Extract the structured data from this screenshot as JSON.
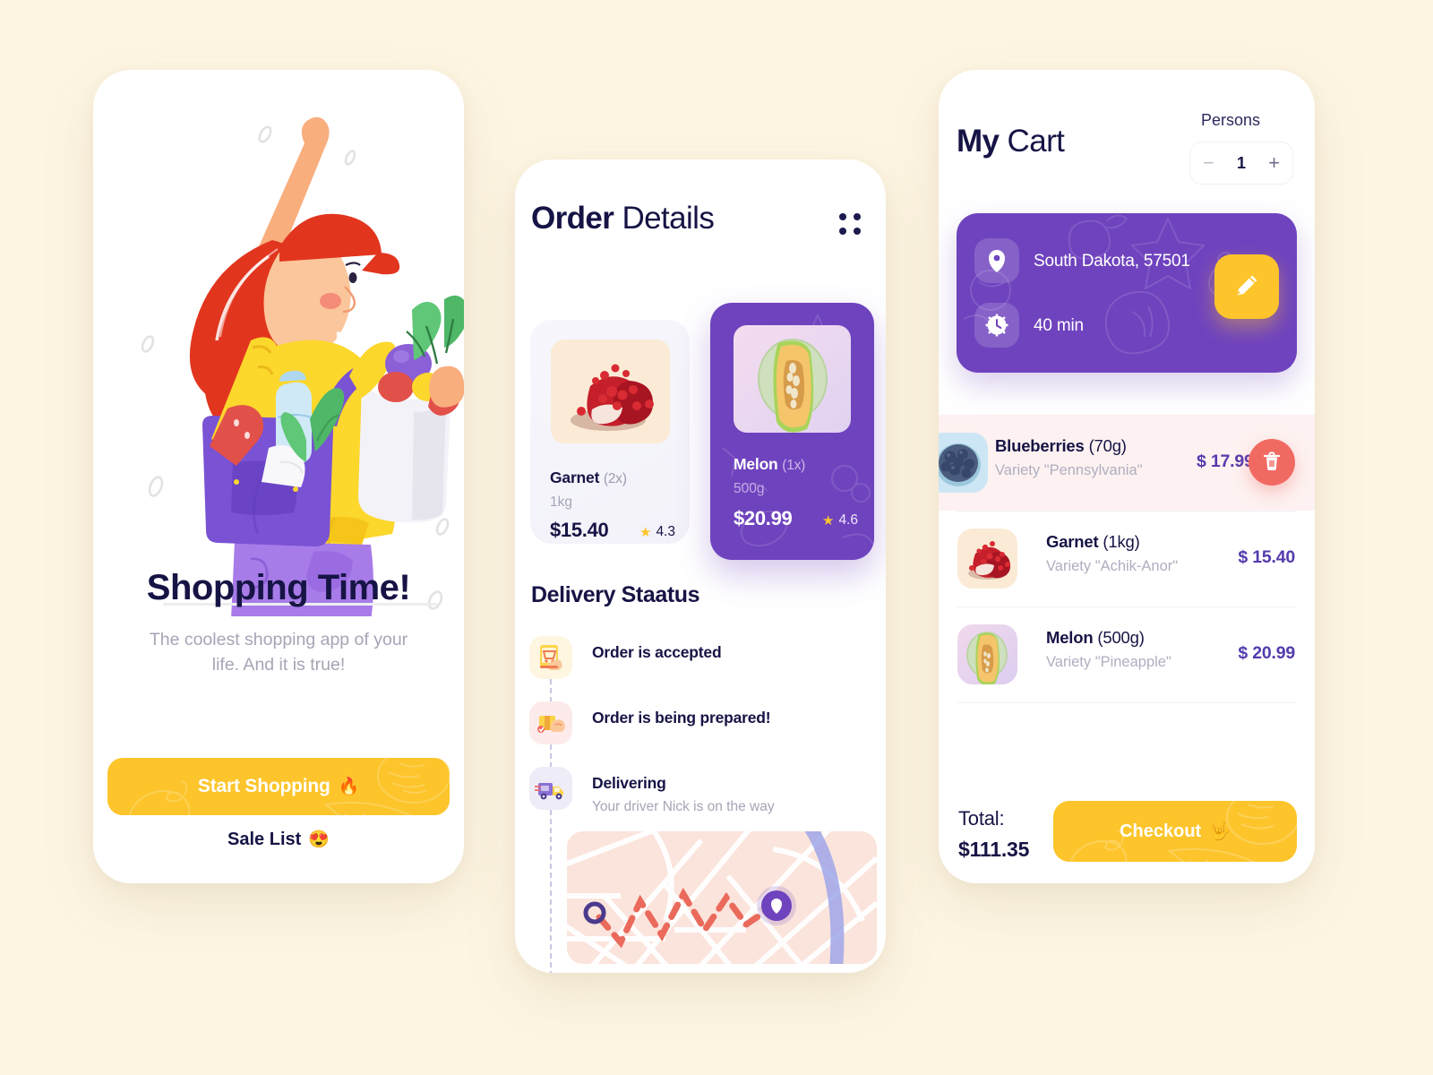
{
  "colors": {
    "background": "#FDF5E2",
    "purple": "#6F43BE",
    "yellow": "#FDC52B",
    "navy": "#161445",
    "red": "#F16A62",
    "price_purple": "#553BAE",
    "muted": "#A5A5B6"
  },
  "onboarding": {
    "title": "Shopping Time!",
    "subtitle": "The coolest shopping app of your life. And it is true!",
    "start_button": "Start Shopping",
    "start_button_emoji": "🔥",
    "sale_link": "Sale List",
    "sale_link_emoji": "😍",
    "illustration": "woman-with-grocery-bags-illustration"
  },
  "order": {
    "title_bold": "Order",
    "title_light": "Details",
    "grip_icon": "grid-dots-icon",
    "products": [
      {
        "name": "Garnet",
        "qty": "(2x)",
        "weight": "1kg",
        "price": "$15.40",
        "rating": "4.3",
        "image": "pomegranate-photo",
        "selected": false
      },
      {
        "name": "Melon",
        "qty": "(1x)",
        "weight": "500g",
        "price": "$20.99",
        "rating": "4.6",
        "image": "melon-photo",
        "selected": true
      }
    ],
    "delivery_title": "Delivery Staatus",
    "steps": [
      {
        "label": "Order is accepted",
        "note": "",
        "icon": "cart-tap-icon",
        "icon_bg": "#FEF6E0"
      },
      {
        "label": "Order is being prepared!",
        "note": "",
        "icon": "package-hand-icon",
        "icon_bg": "#FCEBEA"
      },
      {
        "label": "Delivering",
        "note": "Your driver Nick is on the way",
        "icon": "delivery-truck-icon",
        "icon_bg": "#EEEDF7"
      }
    ],
    "map": {
      "start_marker": "origin-dot-marker",
      "end_marker": "destination-pin-marker",
      "route": "dashed-zigzag-route"
    }
  },
  "cart": {
    "title_bold": "My",
    "title_light": "Cart",
    "persons_label": "Persons",
    "persons_value": "1",
    "minus_label": "−",
    "plus_label": "+",
    "address": "South Dakota, 57501",
    "eta": "40 min",
    "address_icon": "location-pin-icon",
    "eta_icon": "clock-icon",
    "edit_icon": "pencil-edit-icon",
    "trash_icon": "trash-bin-icon",
    "items": [
      {
        "name": "Blueberries",
        "weight": "(70g)",
        "variety": "Variety \"Pennsylvania\"",
        "price": "$ 17.99",
        "image": "blueberries-photo",
        "swiped": true
      },
      {
        "name": "Garnet",
        "weight": "(1kg)",
        "variety": "Variety \"Achik-Anor\"",
        "price": "$ 15.40",
        "image": "pomegranate-photo",
        "swiped": false
      },
      {
        "name": "Melon",
        "weight": "(500g)",
        "variety": "Variety \"Pineapple\"",
        "price": "$ 20.99",
        "image": "melon-photo",
        "swiped": false
      }
    ],
    "total_label": "Total:",
    "total_value": "$111.35",
    "checkout_label": "Checkout",
    "checkout_emoji": "🤟"
  }
}
